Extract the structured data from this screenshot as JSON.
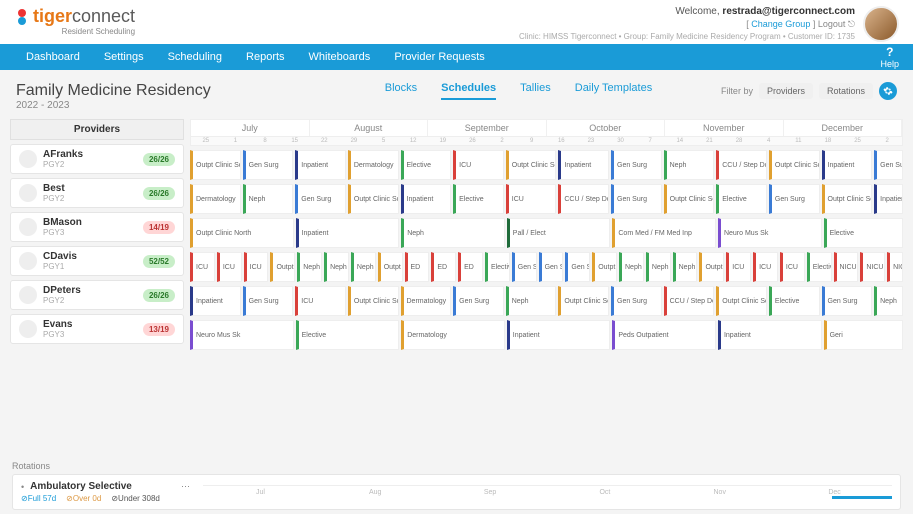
{
  "header": {
    "logo_orange": "tiger",
    "logo_gray": "connect",
    "logo_sub": "Resident Scheduling",
    "welcome_prefix": "Welcome, ",
    "email": "restrada@tigerconnect.com",
    "change_group": "Change Group",
    "logout": "Logout",
    "meta": "Clinic: HIMSS Tigerconnect • Group: Family Medicine Residency Program • Customer ID: 1735"
  },
  "nav": {
    "items": [
      "Dashboard",
      "Settings",
      "Scheduling",
      "Reports",
      "Whiteboards",
      "Provider Requests"
    ],
    "help": "Help"
  },
  "page": {
    "title": "Family Medicine Residency",
    "subtitle": "2022 - 2023",
    "tabs": [
      "Blocks",
      "Schedules",
      "Tallies",
      "Daily Templates"
    ],
    "active_tab": 1,
    "filter_label": "Filter by",
    "filter_providers": "Providers",
    "filter_rotations": "Rotations"
  },
  "months": [
    "July",
    "August",
    "September",
    "October",
    "November",
    "December"
  ],
  "day_ticks": [
    "25",
    "1",
    "8",
    "15",
    "22",
    "29",
    "5",
    "12",
    "19",
    "26",
    "2",
    "9",
    "16",
    "23",
    "30",
    "7",
    "14",
    "21",
    "28",
    "4",
    "11",
    "18",
    "25",
    "2"
  ],
  "providers_header": "Providers",
  "providers": [
    {
      "name": "AFranks",
      "level": "PGY2",
      "badge": "26/26",
      "badge_class": "green"
    },
    {
      "name": "Best",
      "level": "PGY2",
      "badge": "26/26",
      "badge_class": "green"
    },
    {
      "name": "BMason",
      "level": "PGY3",
      "badge": "14/19",
      "badge_class": "red"
    },
    {
      "name": "CDavis",
      "level": "PGY1",
      "badge": "52/52",
      "badge_class": "green"
    },
    {
      "name": "DPeters",
      "level": "PGY2",
      "badge": "26/26",
      "badge_class": "green"
    },
    {
      "name": "Evans",
      "level": "PGY3",
      "badge": "13/19",
      "badge_class": "red"
    }
  ],
  "schedule": [
    [
      {
        "t": "Outpt Clinic South",
        "c": "gold",
        "w": 1
      },
      {
        "t": "Gen Surg",
        "c": "blue",
        "w": 1
      },
      {
        "t": "Inpatient",
        "c": "navy",
        "w": 1
      },
      {
        "t": "Dermatology",
        "c": "gold",
        "w": 1
      },
      {
        "t": "Elective",
        "c": "green",
        "w": 1
      },
      {
        "t": "ICU",
        "c": "red",
        "w": 1
      },
      {
        "t": "Outpt Clinic South",
        "c": "gold",
        "w": 1
      },
      {
        "t": "Inpatient",
        "c": "navy",
        "w": 1
      },
      {
        "t": "Gen Surg",
        "c": "blue",
        "w": 1
      },
      {
        "t": "Neph",
        "c": "green",
        "w": 1
      },
      {
        "t": "CCU / Step Down",
        "c": "red",
        "w": 1
      },
      {
        "t": "Outpt Clinic South",
        "c": "gold",
        "w": 1
      },
      {
        "t": "Inpatient",
        "c": "navy",
        "w": 1
      },
      {
        "t": "Gen Sur",
        "c": "blue",
        "w": 0.5
      }
    ],
    [
      {
        "t": "Dermatology",
        "c": "gold",
        "w": 1
      },
      {
        "t": "Neph",
        "c": "green",
        "w": 1
      },
      {
        "t": "Gen Surg",
        "c": "blue",
        "w": 1
      },
      {
        "t": "Outpt Clinic South",
        "c": "gold",
        "w": 1
      },
      {
        "t": "Inpatient",
        "c": "navy",
        "w": 1
      },
      {
        "t": "Elective",
        "c": "green",
        "w": 1
      },
      {
        "t": "ICU",
        "c": "red",
        "w": 1
      },
      {
        "t": "CCU / Step Down",
        "c": "red",
        "w": 1
      },
      {
        "t": "Gen Surg",
        "c": "blue",
        "w": 1
      },
      {
        "t": "Outpt Clinic South",
        "c": "gold",
        "w": 1
      },
      {
        "t": "Elective",
        "c": "green",
        "w": 1
      },
      {
        "t": "Gen Surg",
        "c": "blue",
        "w": 1
      },
      {
        "t": "Outpt Clinic South",
        "c": "gold",
        "w": 1
      },
      {
        "t": "Inpatien",
        "c": "navy",
        "w": 0.5
      }
    ],
    [
      {
        "t": "Outpt Clinic North",
        "c": "gold",
        "w": 2
      },
      {
        "t": "Inpatient",
        "c": "navy",
        "w": 2
      },
      {
        "t": "Neph",
        "c": "green",
        "w": 2
      },
      {
        "t": "Pall / Elect",
        "c": "dgreen",
        "w": 2
      },
      {
        "t": "Com Med / FM Med Inp",
        "c": "gold",
        "w": 2
      },
      {
        "t": "Neuro Mus Sk",
        "c": "purple",
        "w": 2
      },
      {
        "t": "Elective",
        "c": "green",
        "w": 1.5
      }
    ],
    [
      {
        "t": "ICU",
        "c": "red",
        "w": 1
      },
      {
        "t": "ICU",
        "c": "red",
        "w": 1
      },
      {
        "t": "ICU",
        "c": "red",
        "w": 1
      },
      {
        "t": "Outpt",
        "c": "gold",
        "w": 1
      },
      {
        "t": "Neph",
        "c": "green",
        "w": 1
      },
      {
        "t": "Neph",
        "c": "green",
        "w": 1
      },
      {
        "t": "Neph",
        "c": "green",
        "w": 1
      },
      {
        "t": "Outpt",
        "c": "gold",
        "w": 1
      },
      {
        "t": "ED",
        "c": "red",
        "w": 1
      },
      {
        "t": "ED",
        "c": "red",
        "w": 1
      },
      {
        "t": "ED",
        "c": "red",
        "w": 1
      },
      {
        "t": "Electiv",
        "c": "green",
        "w": 1
      },
      {
        "t": "Gen S",
        "c": "blue",
        "w": 1
      },
      {
        "t": "Gen S",
        "c": "blue",
        "w": 1
      },
      {
        "t": "Gen S",
        "c": "blue",
        "w": 1
      },
      {
        "t": "Outpt",
        "c": "gold",
        "w": 1
      },
      {
        "t": "Neph",
        "c": "green",
        "w": 1
      },
      {
        "t": "Neph",
        "c": "green",
        "w": 1
      },
      {
        "t": "Neph",
        "c": "green",
        "w": 1
      },
      {
        "t": "Outpt",
        "c": "gold",
        "w": 1
      },
      {
        "t": "ICU",
        "c": "red",
        "w": 1
      },
      {
        "t": "ICU",
        "c": "red",
        "w": 1
      },
      {
        "t": "ICU",
        "c": "red",
        "w": 1
      },
      {
        "t": "Electiv",
        "c": "green",
        "w": 1
      },
      {
        "t": "NICU",
        "c": "red",
        "w": 1
      },
      {
        "t": "NICU",
        "c": "red",
        "w": 1
      },
      {
        "t": "NICU",
        "c": "red",
        "w": 0.5
      }
    ],
    [
      {
        "t": "Inpatient",
        "c": "navy",
        "w": 1
      },
      {
        "t": "Gen Surg",
        "c": "blue",
        "w": 1
      },
      {
        "t": "ICU",
        "c": "red",
        "w": 1
      },
      {
        "t": "Outpt Clinic South",
        "c": "gold",
        "w": 1
      },
      {
        "t": "Dermatology",
        "c": "gold",
        "w": 1
      },
      {
        "t": "Gen Surg",
        "c": "blue",
        "w": 1
      },
      {
        "t": "Neph",
        "c": "green",
        "w": 1
      },
      {
        "t": "Outpt Clinic South",
        "c": "gold",
        "w": 1
      },
      {
        "t": "Gen Surg",
        "c": "blue",
        "w": 1
      },
      {
        "t": "CCU / Step Down",
        "c": "red",
        "w": 1
      },
      {
        "t": "Outpt Clinic South",
        "c": "gold",
        "w": 1
      },
      {
        "t": "Elective",
        "c": "green",
        "w": 1
      },
      {
        "t": "Gen Surg",
        "c": "blue",
        "w": 1
      },
      {
        "t": "Neph",
        "c": "green",
        "w": 0.5
      }
    ],
    [
      {
        "t": "Neuro Mus Sk",
        "c": "purple",
        "w": 2
      },
      {
        "t": "Elective",
        "c": "green",
        "w": 2
      },
      {
        "t": "Dermatology",
        "c": "gold",
        "w": 2
      },
      {
        "t": "Inpatient",
        "c": "navy",
        "w": 2
      },
      {
        "t": "Peds Outpatient",
        "c": "purple",
        "w": 2
      },
      {
        "t": "Inpatient",
        "c": "navy",
        "w": 2
      },
      {
        "t": "Geri",
        "c": "gold",
        "w": 1.5
      }
    ]
  ],
  "rotations": {
    "label": "Rotations",
    "title": "Ambulatory Selective",
    "full": "Full 57d",
    "over": "Over 0d",
    "under": "Under 308d",
    "months": [
      "Jul",
      "Aug",
      "Sep",
      "Oct",
      "Nov",
      "Dec"
    ]
  }
}
